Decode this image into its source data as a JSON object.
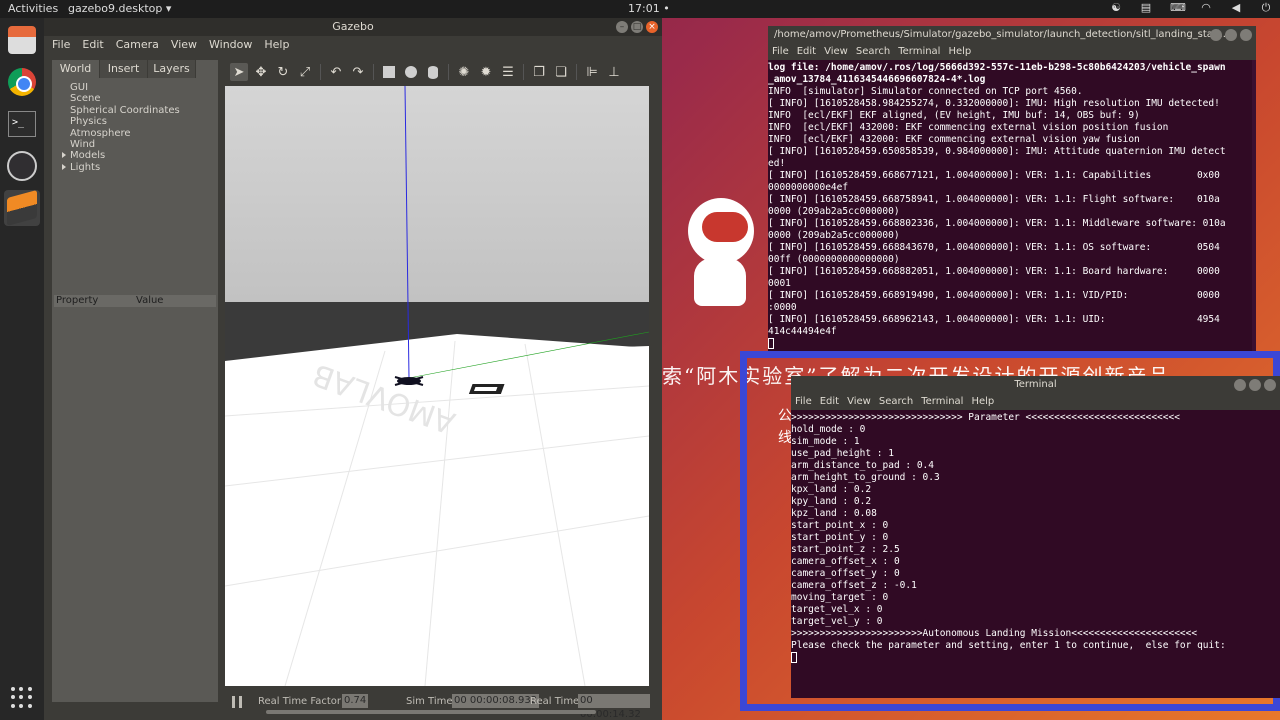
{
  "topbar": {
    "activities": "Activities",
    "app_menu": "gazebo9.desktop ▾",
    "clock": "17:01 •"
  },
  "dock": {
    "items": [
      "files-icon",
      "chrome-icon",
      "terminal-icon",
      "obs-icon",
      "gazebo-icon",
      "app-grid-icon"
    ]
  },
  "gazebo": {
    "title": "Gazebo",
    "menu": [
      "File",
      "Edit",
      "Camera",
      "View",
      "Window",
      "Help"
    ],
    "tabs": [
      "World",
      "Insert",
      "Layers"
    ],
    "tree": [
      "GUI",
      "Scene",
      "Spherical Coordinates",
      "Physics",
      "Atmosphere",
      "Wind",
      "Models",
      "Lights"
    ],
    "property_headers": [
      "Property",
      "Value"
    ],
    "status": {
      "rtf_label": "Real Time Factor:",
      "rtf_value": "0.74",
      "sim_label": "Sim Time:",
      "sim_value": "00 00:00:08.932",
      "real_label": "Real Time:",
      "real_value": "00 00:00:14.32"
    }
  },
  "overlay": {
    "line": "索“阿木实验室”了解为二次开发设计的开源创新产品",
    "small1": "公",
    "small2": "线"
  },
  "terminal1": {
    "title": "/home/amov/Prometheus/Simulator/gazebo_simulator/launch_detection/sitl_landing_stati...",
    "menu": [
      "File",
      "Edit",
      "View",
      "Search",
      "Terminal",
      "Help"
    ],
    "lines": [
      "log file: /home/amov/.ros/log/5666d392-557c-11eb-b298-5c80b6424203/vehicle_spawn",
      "_amov_13784_4116345446696607824-4*.log",
      "INFO  [simulator] Simulator connected on TCP port 4560.",
      "[ INFO] [1610528458.984255274, 0.332000000]: IMU: High resolution IMU detected!",
      "INFO  [ecl/EKF] EKF aligned, (EV height, IMU buf: 14, OBS buf: 9)",
      "INFO  [ecl/EKF] 432000: EKF commencing external vision position fusion",
      "INFO  [ecl/EKF] 432000: EKF commencing external vision yaw fusion",
      "[ INFO] [1610528459.650858539, 0.984000000]: IMU: Attitude quaternion IMU detect",
      "ed!",
      "[ INFO] [1610528459.668677121, 1.004000000]: VER: 1.1: Capabilities        0x00",
      "0000000000e4ef",
      "[ INFO] [1610528459.668758941, 1.004000000]: VER: 1.1: Flight software:    010a",
      "0000 (209ab2a5cc000000)",
      "[ INFO] [1610528459.668802336, 1.004000000]: VER: 1.1: Middleware software: 010a",
      "0000 (209ab2a5cc000000)",
      "[ INFO] [1610528459.668843670, 1.004000000]: VER: 1.1: OS software:        0504",
      "00ff (0000000000000000)",
      "[ INFO] [1610528459.668882051, 1.004000000]: VER: 1.1: Board hardware:     0000",
      "0001",
      "[ INFO] [1610528459.668919490, 1.004000000]: VER: 1.1: VID/PID:            0000",
      ":0000",
      "[ INFO] [1610528459.668962143, 1.004000000]: VER: 1.1: UID:                4954",
      "414c44494e4f"
    ]
  },
  "terminal2": {
    "title": "Terminal",
    "menu": [
      "File",
      "Edit",
      "View",
      "Search",
      "Terminal",
      "Help"
    ],
    "lines": [
      ">>>>>>>>>>>>>>>>>>>>>>>>>>>>>> Parameter <<<<<<<<<<<<<<<<<<<<<<<<<<<",
      "hold_mode : 0",
      "sim_mode : 1",
      "use_pad_height : 1",
      "arm_distance_to_pad : 0.4",
      "arm_height_to_ground : 0.3",
      "kpx_land : 0.2",
      "kpy_land : 0.2",
      "kpz_land : 0.08",
      "start_point_x : 0",
      "start_point_y : 0",
      "start_point_z : 2.5",
      "camera_offset_x : 0",
      "camera_offset_y : 0",
      "camera_offset_z : -0.1",
      "moving_target : 0",
      "target_vel_x : 0",
      "target_vel_y : 0",
      ">>>>>>>>>>>>>>>>>>>>>>>Autonomous Landing Mission<<<<<<<<<<<<<<<<<<<<<<",
      "Please check the parameter and setting, enter 1 to continue,  else for quit:"
    ]
  },
  "colors": {
    "terminal_bg": "#300a24",
    "highlight": "#3b47d6",
    "gazebo_panel": "#5a5955",
    "close_button": "#e8632a"
  }
}
